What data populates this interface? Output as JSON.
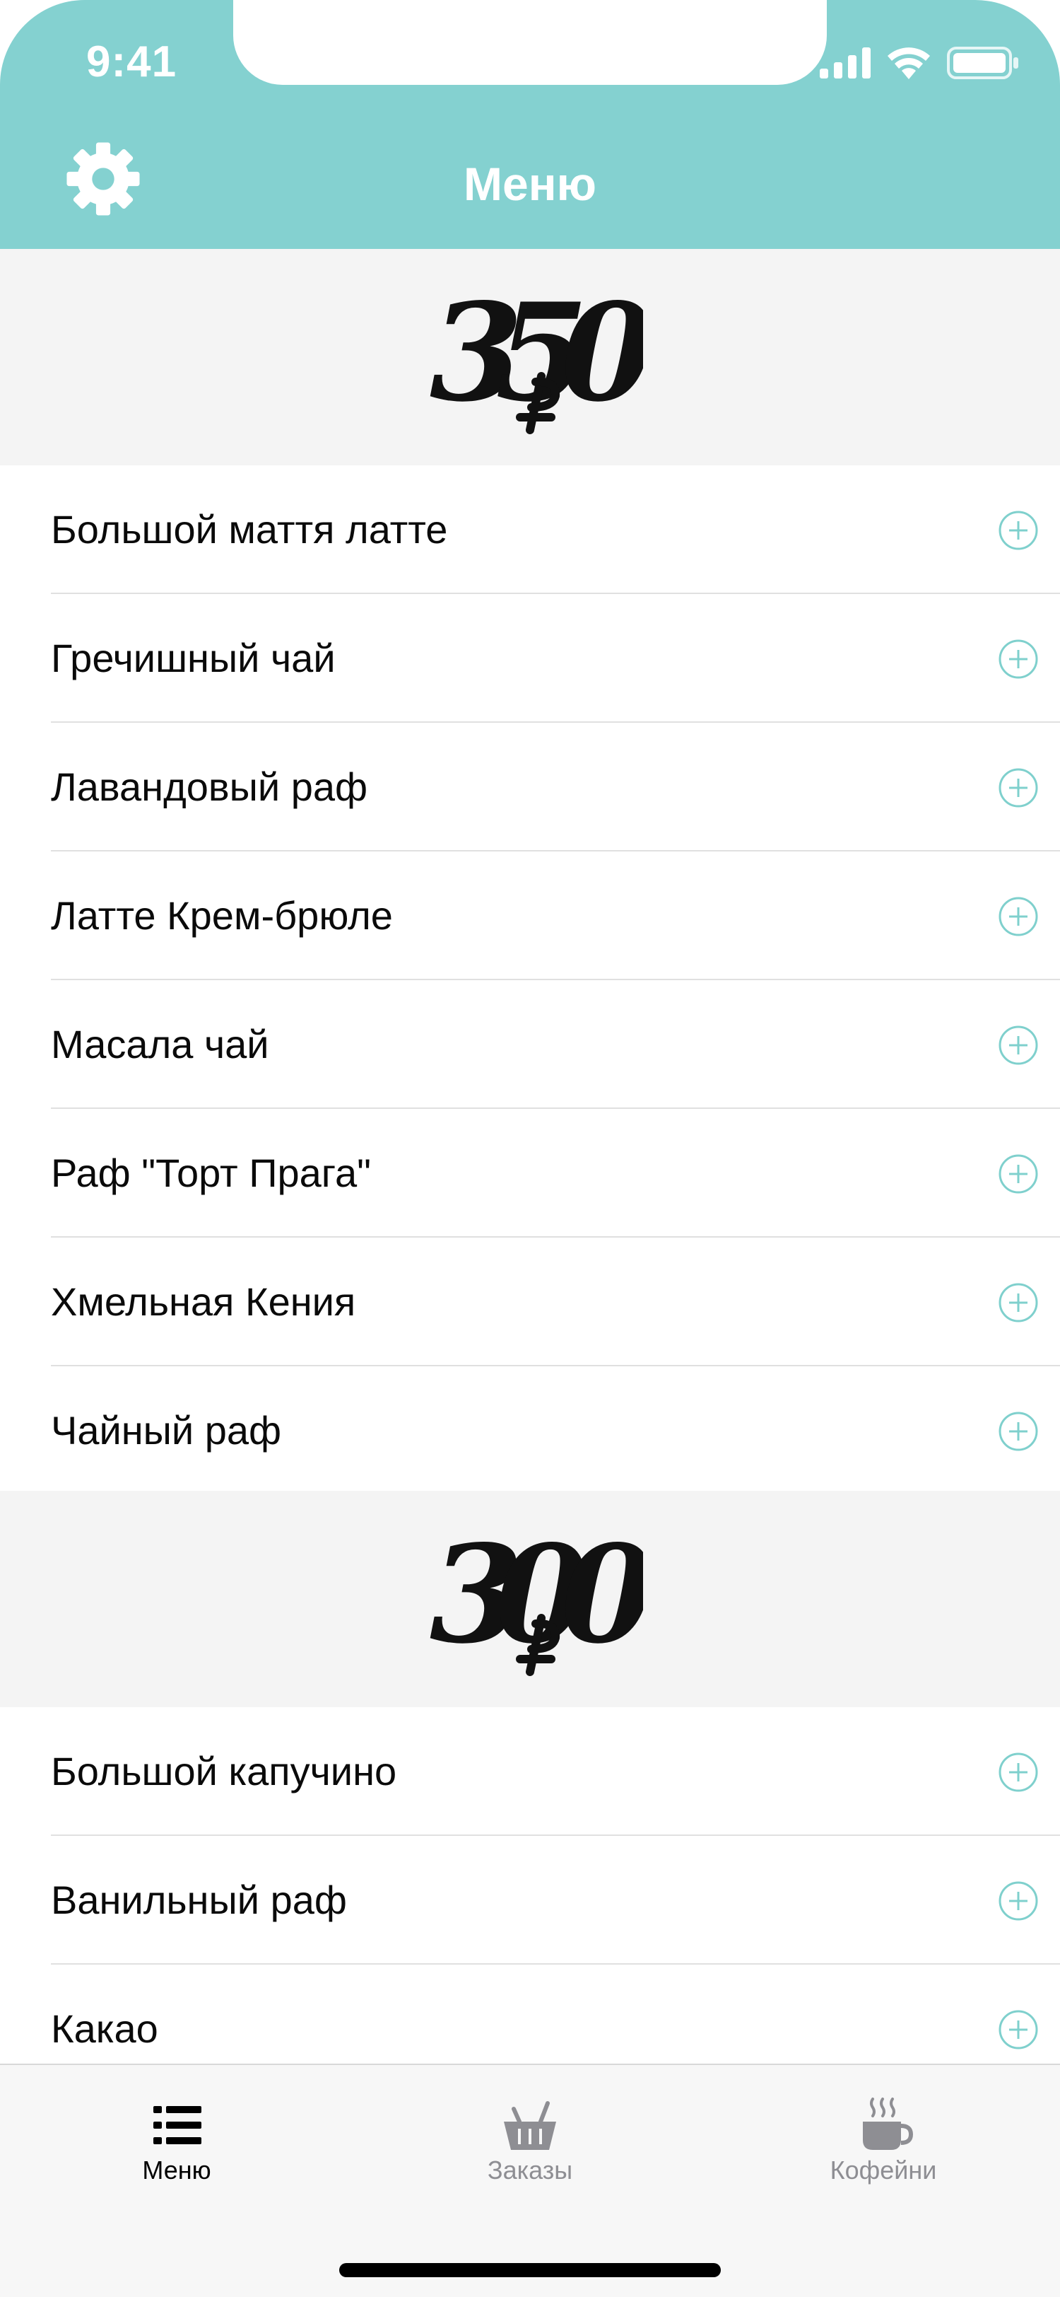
{
  "status_bar": {
    "time": "9:41"
  },
  "nav": {
    "title": "Меню"
  },
  "sections": [
    {
      "price": "350",
      "items": [
        {
          "name": "Большой маття латте"
        },
        {
          "name": "Гречишный чай"
        },
        {
          "name": "Лавандовый раф"
        },
        {
          "name": "Латте Крем-брюле"
        },
        {
          "name": "Масала чай"
        },
        {
          "name": "Раф \"Торт Прага\""
        },
        {
          "name": "Хмельная Кения"
        },
        {
          "name": "Чайный раф"
        }
      ]
    },
    {
      "price": "300",
      "items": [
        {
          "name": "Большой капучино"
        },
        {
          "name": "Ванильный раф"
        },
        {
          "name": "Какао"
        }
      ]
    }
  ],
  "tabs": [
    {
      "label": "Меню",
      "icon": "list-icon",
      "active": true
    },
    {
      "label": "Заказы",
      "icon": "basket-icon",
      "active": false
    },
    {
      "label": "Кофейни",
      "icon": "coffee-cup-icon",
      "active": false
    }
  ],
  "colors": {
    "accent": "#84d1d0",
    "add_icon": "#7fd0cd",
    "tab_active": "#000000",
    "tab_inactive": "#8e8e93",
    "section_bg": "#f4f4f4"
  }
}
